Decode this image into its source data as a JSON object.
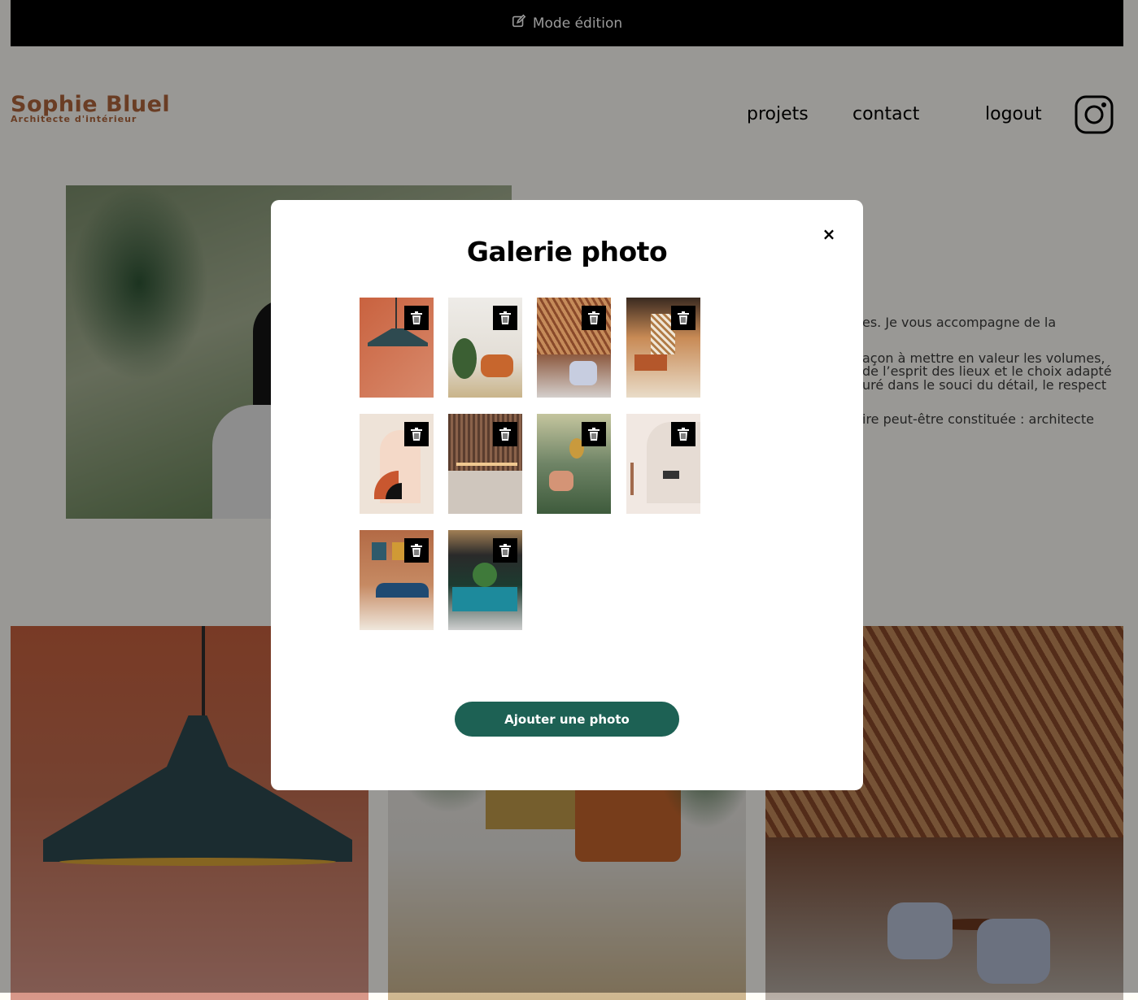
{
  "edit_bar": {
    "label": "Mode édition",
    "icon": "edit-icon"
  },
  "header": {
    "logo_title": "Sophie Bluel",
    "logo_subtitle": "Architecte d'intérieur",
    "nav": [
      "projets",
      "contact",
      "logout"
    ],
    "social_icon": "instagram-icon"
  },
  "about": {
    "lines": [
      "es. Je vous accompagne de la",
      "açon à mettre en valeur les volumes,",
      "de l’esprit des lieux et le choix adapté",
      "uré dans le souci du détail, le respect",
      "ire peut-être constituée : architecte"
    ]
  },
  "modal": {
    "title": "Galerie photo",
    "close_label": "×",
    "add_button_label": "Ajouter une photo",
    "photo_count": 10
  },
  "colors": {
    "brand": "#b1663c",
    "primary_button": "#1d6154",
    "edit_bar": "#000000",
    "background": "#fffef8"
  }
}
